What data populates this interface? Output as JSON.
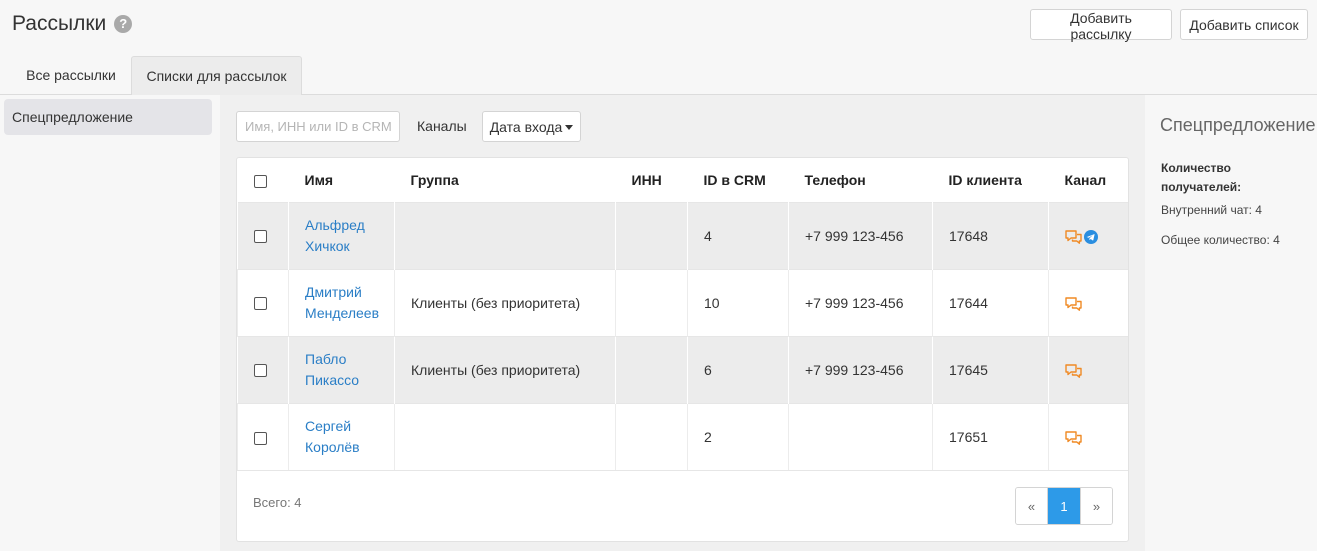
{
  "header": {
    "title": "Рассылки",
    "help_icon": "?",
    "add_mailing_label": "Добавить рассылку",
    "add_list_label": "Добавить список"
  },
  "tabs": [
    {
      "label": "Все рассылки",
      "active": false
    },
    {
      "label": "Списки для рассылок",
      "active": true
    }
  ],
  "sidebar": {
    "items": [
      {
        "label": "Спецпредложение",
        "selected": true
      }
    ]
  },
  "filters": {
    "search_placeholder": "Имя, ИНН или ID в CRM",
    "channels_label": "Каналы",
    "date_label": "Дата входа"
  },
  "table": {
    "headers": [
      "Имя",
      "Группа",
      "ИНН",
      "ID в CRM",
      "Телефон",
      "ID клиента",
      "Канал"
    ],
    "rows": [
      {
        "name": "Альфред Хичкок",
        "group": "",
        "inn": "",
        "crm_id": "4",
        "phone": "+7 999 123-456",
        "client_id": "17648",
        "channels": [
          "chat-icon",
          "telegram-icon"
        ]
      },
      {
        "name": "Дмитрий Менделеев",
        "group": "Клиенты (без приоритета)",
        "inn": "",
        "crm_id": "10",
        "phone": "+7 999 123-456",
        "client_id": "17644",
        "channels": [
          "chat-icon"
        ]
      },
      {
        "name": "Пабло Пикассо",
        "group": "Клиенты (без приоритета)",
        "inn": "",
        "crm_id": "6",
        "phone": "+7 999 123-456",
        "client_id": "17645",
        "channels": [
          "chat-icon"
        ]
      },
      {
        "name": "Сергей Королёв",
        "group": "",
        "inn": "",
        "crm_id": "2",
        "phone": "",
        "client_id": "17651",
        "channels": [
          "chat-icon"
        ]
      }
    ]
  },
  "footer": {
    "total": "Всего: 4",
    "prev": "«",
    "page": "1",
    "next": "»"
  },
  "details": {
    "title": "Спецпредложение",
    "recipients_label": "Количество получателей:",
    "internal_chat": "Внутренний чат: 4",
    "total_count": "Общее количество: 4"
  },
  "colors": {
    "link": "#2a7ec6",
    "chat_icon": "#f08a24",
    "telegram_icon": "#2a8ee0",
    "active_page": "#2d9ae8"
  }
}
